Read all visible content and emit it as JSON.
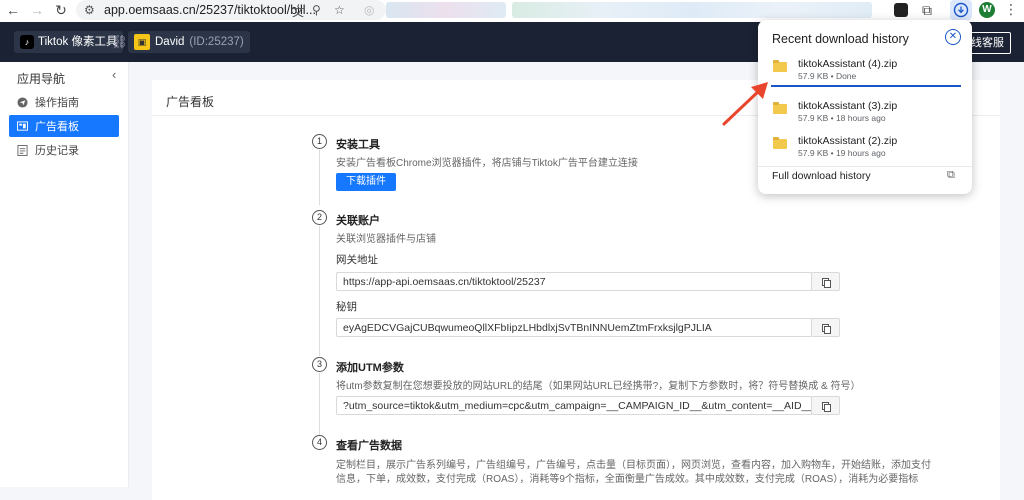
{
  "browser": {
    "url": "app.oemsaas.cn/25237/tiktoktool/bill...",
    "avatar_letter": "W"
  },
  "header": {
    "shop_label": "Tiktok 像素工具",
    "user_name": "David",
    "user_id": "(ID:25237)",
    "service_label": "线客服"
  },
  "sidebar": {
    "title": "应用导航",
    "items": [
      {
        "label": "操作指南",
        "icon": "send-icon"
      },
      {
        "label": "广告看板",
        "icon": "dashboard-icon"
      },
      {
        "label": "历史记录",
        "icon": "history-icon"
      }
    ]
  },
  "main": {
    "card_title": "广告看板",
    "steps": [
      {
        "num": "1",
        "title": "安装工具",
        "desc": "安装广告看板Chrome浏览器插件，将店铺与Tiktok广告平台建立连接",
        "button": "下载插件"
      },
      {
        "num": "2",
        "title": "关联账户",
        "desc": "关联浏览器插件与店铺",
        "fields": [
          {
            "label": "网关地址",
            "value": "https://app-api.oemsaas.cn/tiktoktool/25237"
          },
          {
            "label": "秘钥",
            "value": "eyAgEDCVGajCUBqwumeoQllXFbIipzLHbdlxjSvTBnINNUemZtmFrxksjlgPJLIA"
          }
        ]
      },
      {
        "num": "3",
        "title": "添加UTM参数",
        "desc": "将utm参数复制在您想要投放的网站URL的结尾（如果网站URL已经携带?，复制下方参数时，将？符号替换成 & 符号）",
        "fields": [
          {
            "label": "",
            "value": "?utm_source=tiktok&utm_medium=cpc&utm_campaign=__CAMPAIGN_ID__&utm_content=__AID__&utm_term=__C"
          }
        ]
      },
      {
        "num": "4",
        "title": "查看广告数据",
        "desc_lines": [
          "定制栏目，展示广告系列编号，广告组编号，广告编号，点击量（目标页面），网页浏览，查看内容，加入购物车，开始结账，添加支付",
          "信息，下单，成效数，支付完成（ROAS），消耗等9个指标，全面衡量广告成效。其中成效数，支付完成（ROAS），消耗为必要指标"
        ]
      }
    ]
  },
  "downloads": {
    "title": "Recent download history",
    "items": [
      {
        "name": "tiktokAssistant (4).zip",
        "meta": "57.9 KB • Done"
      },
      {
        "name": "tiktokAssistant (3).zip",
        "meta": "57.9 KB • 18 hours ago"
      },
      {
        "name": "tiktokAssistant (2).zip",
        "meta": "57.9 KB • 19 hours ago"
      }
    ],
    "full_history": "Full download history"
  },
  "colors": {
    "accent": "#1677ff",
    "header_bg": "#1b2233",
    "arrow": "#e8452c"
  }
}
